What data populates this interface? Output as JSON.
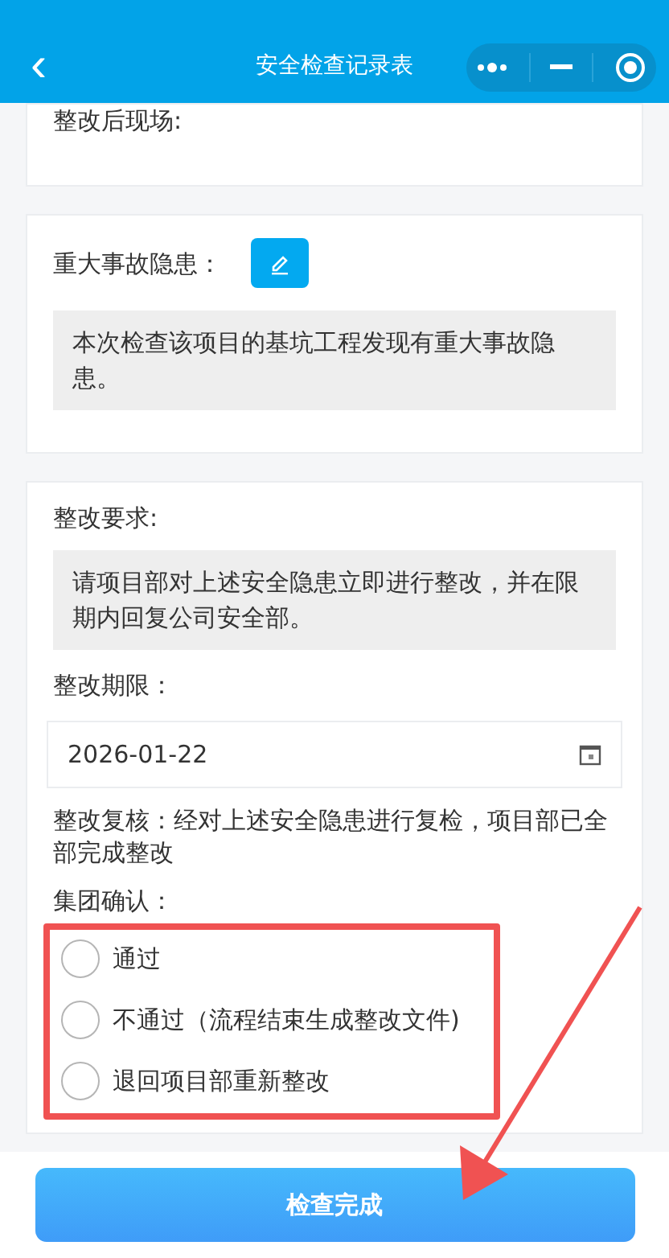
{
  "header": {
    "back": "‹",
    "title": "安全检查记录表"
  },
  "after_photos": {
    "label": "整改后现场:"
  },
  "major_hazard": {
    "label": "重大事故隐患：",
    "text": "本次检查该项目的基坑工程发现有重大事故隐患。"
  },
  "rectification": {
    "requirement_label": "整改要求:",
    "requirement_text": "请项目部对上述安全隐患立即进行整改，并在限期内回复公司安全部。",
    "deadline_label": "整改期限：",
    "deadline_value": "2026-01-22",
    "review_text": "整改复核：经对上述安全隐患进行复检，项目部已全部完成整改",
    "confirm_label": "集团确认：",
    "options": [
      {
        "label": "通过",
        "selected": false
      },
      {
        "label": "不通过（流程结束生成整改文件)",
        "selected": false
      },
      {
        "label": "退回项目部重新整改",
        "selected": false
      }
    ]
  },
  "submit_button": "检查完成"
}
